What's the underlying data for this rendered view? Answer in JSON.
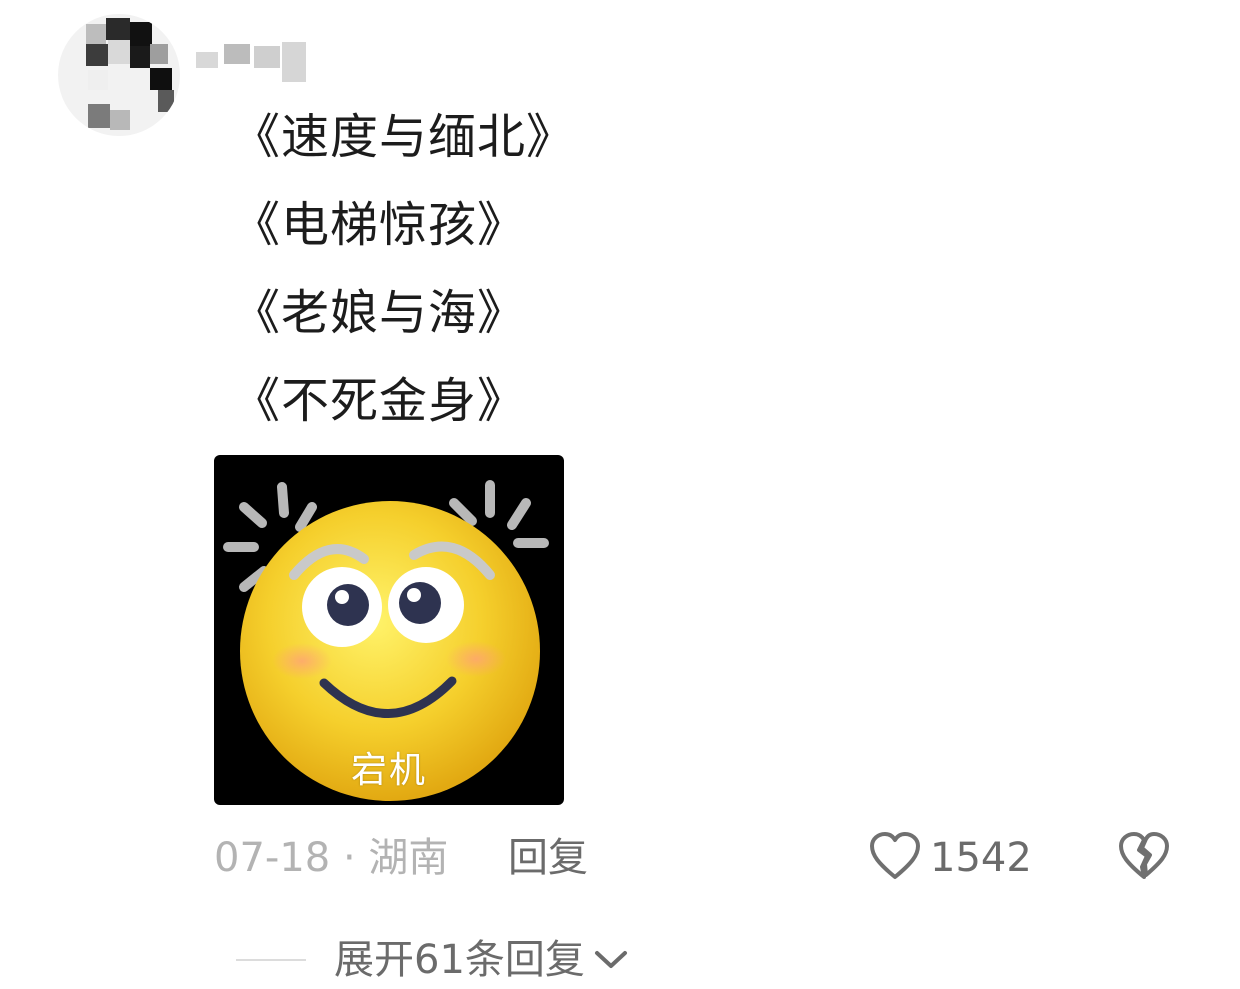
{
  "comment": {
    "author": {
      "avatar": "avatar-pixelated",
      "name_redacted": true
    },
    "lines": [
      "《速度与缅北》",
      "《电梯惊孩》",
      "《老娘与海》",
      "《不死金身》"
    ],
    "sticker": {
      "caption": "宕机",
      "description_icon": "dizzy-smiley-emoji"
    },
    "meta": {
      "date_location": "07-18 · 湖南",
      "reply_label": "回复"
    },
    "like": {
      "icon": "heart-outline-icon",
      "count": "1542"
    },
    "dislike": {
      "icon": "broken-heart-icon"
    },
    "expand": {
      "label": "展开61条回复",
      "icon": "chevron-down-icon"
    }
  },
  "colors": {
    "text_primary": "#1c1c1c",
    "text_muted": "#b3b3b3",
    "text_secondary": "#6b6b6b",
    "divider": "#dcdcdc",
    "emoji_yellow": "#f5cf2c"
  }
}
